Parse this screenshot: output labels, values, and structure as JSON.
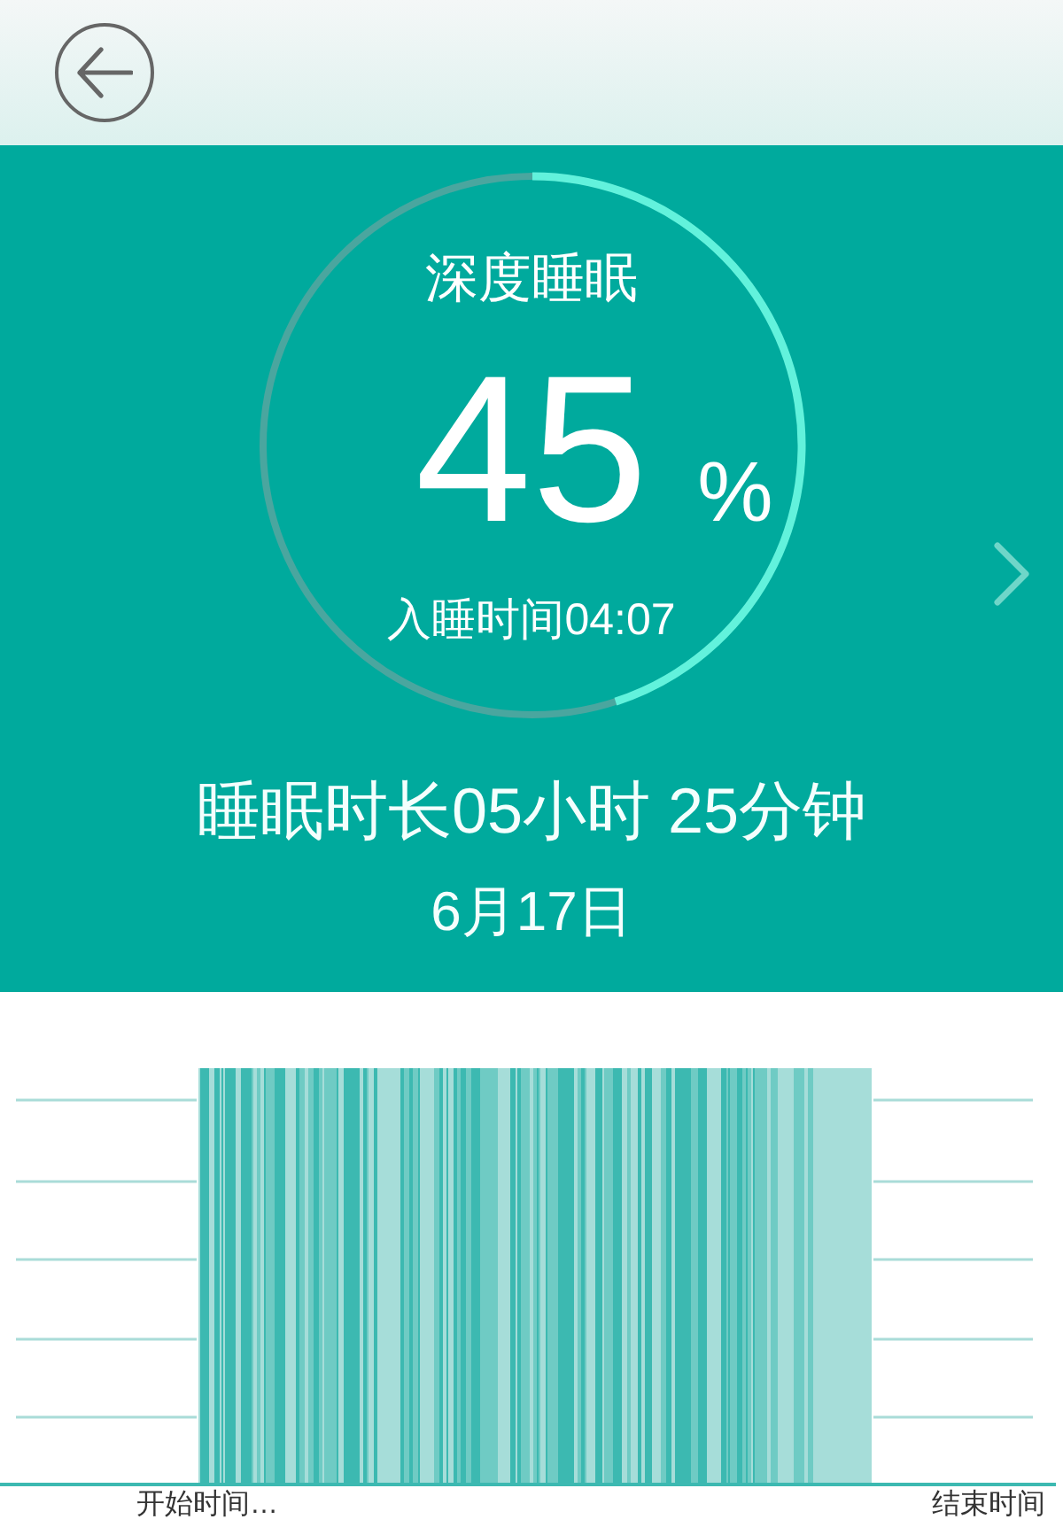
{
  "summary": {
    "stage": "深度睡眠",
    "percent": "45",
    "percent_sign": "%",
    "level": 0.45,
    "sleep_onset": "入睡时间04:07",
    "duration": "睡眠时长05小时 25分钟",
    "date": "6月17日"
  },
  "sleep_chart": {
    "start_label": "开始时间…",
    "end_label": "结束时间"
  }
}
